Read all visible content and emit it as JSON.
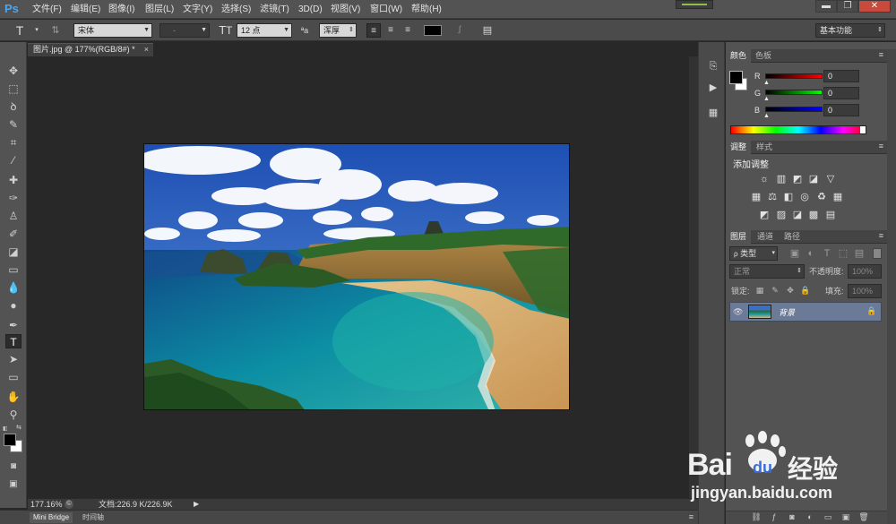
{
  "app": {
    "logo": "Ps"
  },
  "menu": [
    "文件(F)",
    "编辑(E)",
    "图像(I)",
    "图层(L)",
    "文字(Y)",
    "选择(S)",
    "滤镜(T)",
    "3D(D)",
    "视图(V)",
    "窗口(W)",
    "帮助(H)"
  ],
  "window_buttons": {
    "minimize": "▬",
    "maximize": "❐",
    "close": "✕"
  },
  "options": {
    "font_family": "宋体",
    "font_style": "-",
    "font_size": "12 点",
    "aa_label": "ªa",
    "anti_alias": "浑厚",
    "workspace": "基本功能",
    "text_color": "#000000"
  },
  "document": {
    "tab_title": "图片.jpg @ 177%(RGB/8#) *",
    "zoom": "177.16%",
    "doc_info": "文档:226.9 K/226.9K"
  },
  "bottom_tabs": [
    "Mini Bridge",
    "时间轴"
  ],
  "color_panel": {
    "tabs": [
      "颜色",
      "色板"
    ],
    "channels": [
      {
        "label": "R",
        "value": "0"
      },
      {
        "label": "G",
        "value": "0"
      },
      {
        "label": "B",
        "value": "0"
      }
    ],
    "foreground": "#000000",
    "background": "#ffffff"
  },
  "adjustments_panel": {
    "tabs": [
      "调整",
      "样式"
    ],
    "title": "添加调整"
  },
  "layers_panel": {
    "tabs": [
      "图层",
      "通道",
      "路径"
    ],
    "filter_type": "类型",
    "blend_mode": "正常",
    "opacity_label": "不透明度:",
    "opacity_value": "100%",
    "lock_label": "锁定:",
    "fill_label": "填充:",
    "fill_value": "100%",
    "layers": [
      {
        "name": "背景",
        "locked": true,
        "visible": true
      }
    ]
  },
  "watermark": {
    "brand": "Bai",
    "paw": "du",
    "cn": "经验",
    "url": "jingyan.baidu.com"
  },
  "colors": {
    "accent": "#4aa6f0",
    "panel_bg": "#535353",
    "canvas_bg": "#282828",
    "layer_selected": "#6b7b97"
  }
}
